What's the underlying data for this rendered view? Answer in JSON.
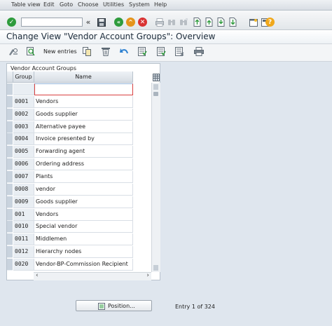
{
  "menu": [
    "Table view",
    "Edit",
    "Goto",
    "Choose",
    "Utilities",
    "System",
    "Help"
  ],
  "command_field": {
    "value": ""
  },
  "title": "Change View \"Vendor Account Groups\": Overview",
  "toolbar": {
    "new_entries": "New entries"
  },
  "table": {
    "title": "Vendor Account Groups",
    "columns": [
      "Group",
      "Name"
    ],
    "rows": [
      {
        "group": "",
        "name": ""
      },
      {
        "group": "0001",
        "name": "Vendors"
      },
      {
        "group": "0002",
        "name": "Goods supplier"
      },
      {
        "group": "0003",
        "name": "Alternative payee"
      },
      {
        "group": "0004",
        "name": "Invoice presented by"
      },
      {
        "group": "0005",
        "name": "Forwarding agent"
      },
      {
        "group": "0006",
        "name": "Ordering address"
      },
      {
        "group": "0007",
        "name": "Plants"
      },
      {
        "group": "0008",
        "name": "vendor"
      },
      {
        "group": "0009",
        "name": "Goods supplier"
      },
      {
        "group": "001",
        "name": "Vendors"
      },
      {
        "group": "0010",
        "name": "Special vendor"
      },
      {
        "group": "0011",
        "name": "Middlemen"
      },
      {
        "group": "0012",
        "name": "Hierarchy nodes"
      },
      {
        "group": "0020",
        "name": "Vendor-BP-Commission Recipient"
      }
    ]
  },
  "position_button": "Position...",
  "entry_info": "Entry 1 of 324",
  "colors": {
    "green": "#2e9b3c",
    "orange": "#e5941c",
    "red": "#d93232",
    "help": "#f0a81c"
  }
}
